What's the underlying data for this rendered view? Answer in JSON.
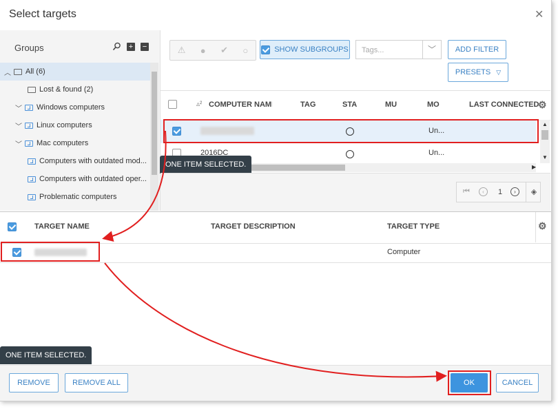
{
  "dialog": {
    "title": "Select targets",
    "close_glyph": "✕"
  },
  "groups": {
    "label": "Groups",
    "icons": [
      "search-icon",
      "add-icon",
      "remove-icon"
    ],
    "items": [
      {
        "label": "All (6)",
        "expanded": true,
        "selected": true,
        "dynamic": false
      },
      {
        "label": "Lost & found (2)",
        "expanded": false,
        "selected": false,
        "dynamic": false
      },
      {
        "label": "Windows computers",
        "expanded": true,
        "selected": false,
        "dynamic": true
      },
      {
        "label": "Linux computers",
        "expanded": true,
        "selected": false,
        "dynamic": true
      },
      {
        "label": "Mac computers",
        "expanded": true,
        "selected": false,
        "dynamic": true
      },
      {
        "label": "Computers with outdated mod...",
        "expanded": false,
        "selected": false,
        "dynamic": true
      },
      {
        "label": "Computers with outdated oper...",
        "expanded": false,
        "selected": false,
        "dynamic": true
      },
      {
        "label": "Problematic computers",
        "expanded": false,
        "selected": false,
        "dynamic": true
      }
    ]
  },
  "toolbar": {
    "status_icons": [
      "⚠",
      "●",
      "✔",
      "○"
    ],
    "show_subgroups": "SHOW SUBGROUPS",
    "tags_placeholder": "Tags...",
    "add_filter": "ADD FILTER",
    "presets": "PRESETS"
  },
  "grid": {
    "sort_indicator": "▵²",
    "columns": [
      "COMPUTER NAME",
      "TAGS",
      "STATUS",
      "MUTED",
      "MODULES",
      "LAST CONNECTED"
    ],
    "col_labels": {
      "computer_name": "COMPUTER NAME",
      "tags": "TAG",
      "status": "STA",
      "muted": "MU",
      "modules": "MO",
      "last_connected": "LAST CONNECTED"
    },
    "rows": [
      {
        "name": "",
        "modules": "Un...",
        "checked": true
      },
      {
        "name": "2016DC",
        "modules": "Un...",
        "checked": false
      }
    ],
    "tooltip": "ONE ITEM SELECTED."
  },
  "pager": {
    "page": "1"
  },
  "targets": {
    "headers": {
      "name": "TARGET NAME",
      "description": "TARGET DESCRIPTION",
      "type": "TARGET TYPE"
    },
    "rows": [
      {
        "name": "",
        "type": "Computer",
        "checked": true
      }
    ],
    "tooltip": "ONE ITEM SELECTED."
  },
  "footer": {
    "remove": "REMOVE",
    "remove_all": "REMOVE ALL",
    "ok": "OK",
    "cancel": "CANCEL"
  },
  "colors": {
    "accent": "#3d94df",
    "highlight": "#e11f1f"
  }
}
